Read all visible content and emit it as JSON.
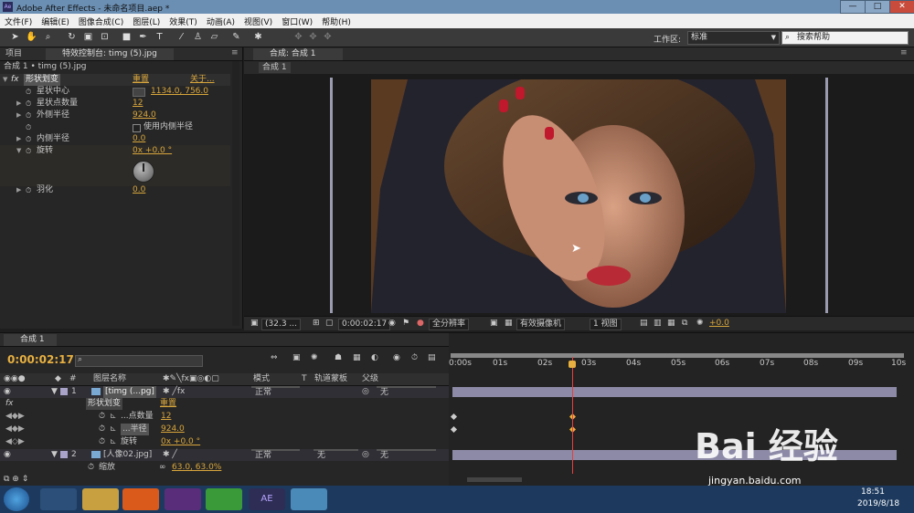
{
  "window": {
    "title": "Adobe After Effects - 未命名项目.aep *",
    "minimize": "—",
    "maximize": "□",
    "close": "✕"
  },
  "menu": [
    "文件(F)",
    "编辑(E)",
    "图像合成(C)",
    "图层(L)",
    "效果(T)",
    "动画(A)",
    "视图(V)",
    "窗口(W)",
    "帮助(H)"
  ],
  "toolbar": {
    "workspace_label": "工作区:",
    "workspace_value": "标准",
    "help_placeholder": "搜索帮助"
  },
  "effect_panel": {
    "tab_project": "项目",
    "tab_effect": "特效控制台: timg (5).jpg",
    "breadcrumb": "合成 1 • timg (5).jpg",
    "effect_name": "形状划变",
    "reset": "重置",
    "about": "关于...",
    "props": [
      {
        "label": "星状中心",
        "value": "1134.0, 756.0"
      },
      {
        "label": "星状点数量",
        "value": "12"
      },
      {
        "label": "外侧半径",
        "value": "924.0"
      },
      {
        "label": "使用内侧半径",
        "value": ""
      },
      {
        "label": "内侧半径",
        "value": "0.0"
      },
      {
        "label": "旋转",
        "value": "0x +0.0 °"
      },
      {
        "label": "羽化",
        "value": "0.0"
      }
    ]
  },
  "viewer": {
    "tab": "合成: 合成 1",
    "subtab": "合成 1",
    "zoom": "(32.3 ...",
    "timecode": "0:00:02:17",
    "resolution": "全分辨率",
    "camera": "有效摄像机",
    "views": "1 视图",
    "exposure": "+0.0"
  },
  "timeline": {
    "tab": "合成 1",
    "timecode": "0:00:02:17",
    "col_headers": {
      "name": "图层名称",
      "mode": "模式",
      "trkmat": "轨道蒙板",
      "parent": "父级"
    },
    "ruler": [
      "0:00s",
      "01s",
      "02s",
      "03s",
      "04s",
      "05s",
      "06s",
      "07s",
      "08s",
      "09s",
      "10s"
    ],
    "layers": [
      {
        "num": "1",
        "name": "[timg (...pg]",
        "mode": "正常",
        "parent": "无"
      },
      {
        "effect": "形状划变",
        "reset": "重置"
      },
      {
        "prop": "...点数量",
        "value": "12"
      },
      {
        "prop": "...半径",
        "value": "924.0"
      },
      {
        "prop": "旋转",
        "value": "0x +0.0 °"
      },
      {
        "num": "2",
        "name": "[人像02.jpg]",
        "mode": "正常",
        "trkmat": "无",
        "parent": "无"
      },
      {
        "prop": "缩放",
        "value": "63.0, 63.0%"
      }
    ],
    "current_time_fraction": 0.27
  },
  "taskbar": {
    "time": "18:51",
    "date": "2019/8/18",
    "ae_label": "AE"
  },
  "watermark": {
    "brand": "Bai 经验",
    "url": "jingyan.baidu.com"
  },
  "colors": {
    "accent": "#d9a63b",
    "playhead": "#e84040",
    "title_bar": "#6b8fb3"
  }
}
